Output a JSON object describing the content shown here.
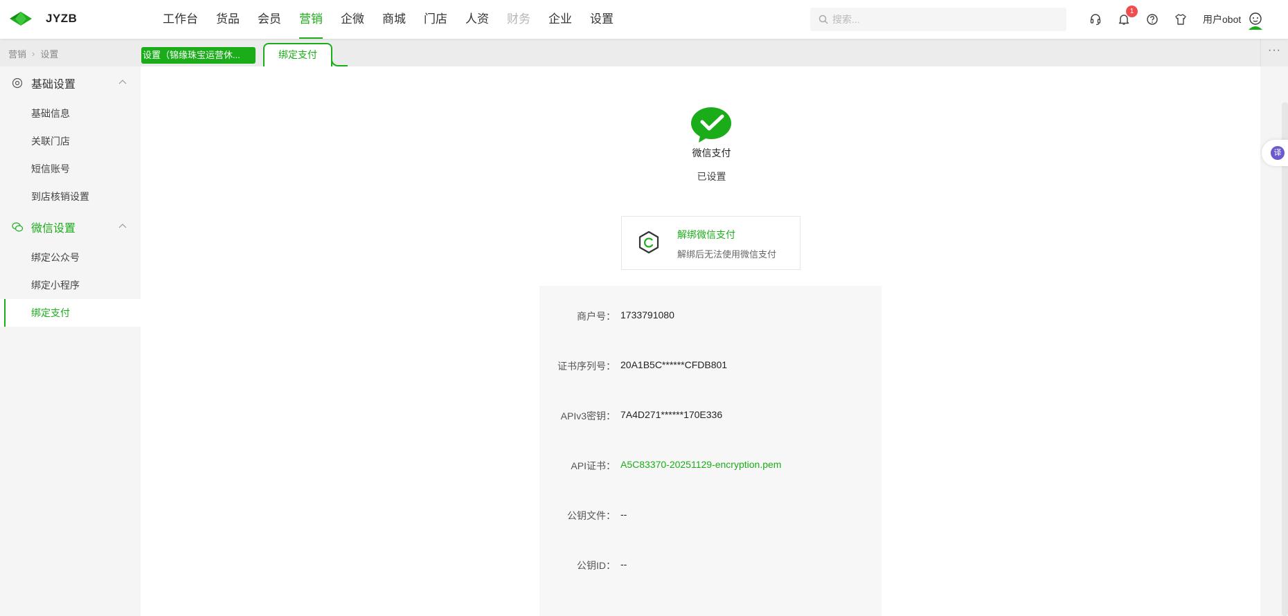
{
  "header": {
    "brand": "JYZB",
    "nav": [
      {
        "label": "工作台",
        "state": "normal"
      },
      {
        "label": "货品",
        "state": "normal"
      },
      {
        "label": "会员",
        "state": "normal"
      },
      {
        "label": "营销",
        "state": "active"
      },
      {
        "label": "企微",
        "state": "normal"
      },
      {
        "label": "商城",
        "state": "normal"
      },
      {
        "label": "门店",
        "state": "normal"
      },
      {
        "label": "人资",
        "state": "normal"
      },
      {
        "label": "财务",
        "state": "disabled"
      },
      {
        "label": "企业",
        "state": "normal"
      },
      {
        "label": "设置",
        "state": "normal"
      }
    ],
    "search_placeholder": "搜索...",
    "notification_count": "1",
    "user_name": "用户obot",
    "icons": [
      "headset-icon",
      "bell-icon",
      "help-icon",
      "shirt-icon"
    ]
  },
  "breadcrumb": {
    "parent": "营销",
    "current": "设置"
  },
  "tabs": {
    "first": "设置（锦缘珠宝运营休...",
    "active": "绑定支付",
    "more": "···"
  },
  "sidebar": {
    "groups": [
      {
        "label": "基础设置",
        "items": [
          "基础信息",
          "关联门店",
          "短信账号",
          "到店核销设置"
        ]
      },
      {
        "label": "微信设置",
        "items": [
          "绑定公众号",
          "绑定小程序",
          "绑定支付"
        ]
      }
    ],
    "active_item": "绑定支付"
  },
  "main": {
    "wechat_pay_title": "微信支付",
    "status": "已设置",
    "unbind_title": "解绑微信支付",
    "unbind_desc": "解绑后无法使用微信支付",
    "fields": [
      {
        "label": "商户号：",
        "value": "1733791080"
      },
      {
        "label": "证书序列号：",
        "value": "20A1B5C******CFDB801"
      },
      {
        "label": "APIv3密钥：",
        "value": "7A4D271******170E336"
      },
      {
        "label": "API证书：",
        "value": "A5C83370-20251129-encryption.pem"
      },
      {
        "label": "公钥文件：",
        "value": "--"
      },
      {
        "label": "公钥ID：",
        "value": "--"
      }
    ]
  },
  "translate_label": "译",
  "colors": {
    "accent": "#1aad19",
    "badge": "#f04e4e"
  }
}
